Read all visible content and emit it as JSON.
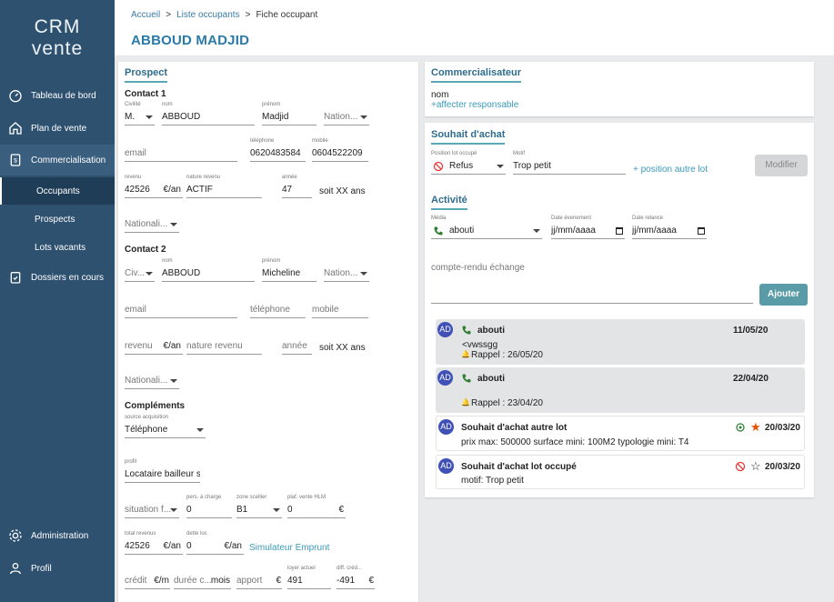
{
  "sidebar": {
    "logo_line1": "CRM",
    "logo_line2": "vente",
    "items": [
      {
        "label": "Tableau de bord"
      },
      {
        "label": "Plan de vente"
      },
      {
        "label": "Commercialisation"
      },
      {
        "label": "Dossiers en cours"
      }
    ],
    "sub_items": [
      {
        "label": "Occupants"
      },
      {
        "label": "Prospects"
      },
      {
        "label": "Lots vacants"
      }
    ],
    "bottom_items": [
      {
        "label": "Administration"
      },
      {
        "label": "Profil"
      }
    ]
  },
  "header": {
    "breadcrumb": [
      "Accueil",
      "Liste occupants",
      "Fiche occupant"
    ],
    "breadcrumb_sep": ">",
    "title": "ABBOUD MADJID"
  },
  "prospect": {
    "title": "Prospect",
    "contact1": {
      "title": "Contact 1",
      "civilite_label": "Civilité",
      "civilite": "M.",
      "nom_label": "nom",
      "nom": "ABBOUD",
      "prenom_label": "prénom",
      "prenom": "Madjid",
      "nation": "Nation...",
      "email": "email",
      "tel_label": "téléphone",
      "tel": "0620483584",
      "mobile_label": "mobile",
      "mobile": "0604522209",
      "revenu_label": "revenu",
      "revenu": "42526",
      "revenu_unit": "€/an",
      "nature_label": "nature revenu",
      "nature": "ACTIF",
      "annee_label": "année",
      "annee": "47",
      "age_text": "soit XX ans",
      "nationalite": "Nationali..."
    },
    "contact2": {
      "title": "Contact 2",
      "civilite": "Civ...",
      "nom_label": "nom",
      "nom": "ABBOUD",
      "prenom_label": "prénom",
      "prenom": "Micheline",
      "nation": "Nation...",
      "email": "email",
      "tel": "téléphone",
      "mobile": "mobile",
      "revenu": "revenu",
      "revenu_unit": "€/an",
      "nature": "nature revenu",
      "annee": "année",
      "age_text": "soit XX ans",
      "nationalite": "Nationali..."
    },
    "complements": {
      "title": "Compléments",
      "source_label": "source acquisition",
      "source": "Téléphone",
      "profil_label": "profil",
      "profil": "Locataire bailleur so",
      "situation": "situation f...",
      "pers_label": "pers. à charge",
      "pers": "0",
      "zone_label": "zone scellier",
      "zone": "B1",
      "plaf_label": "plaf. vente HLM",
      "plaf": "0",
      "plaf_unit": "€",
      "total_label": "total revenus",
      "total": "42526",
      "total_unit": "€/an",
      "dette_label": "dette loc",
      "dette": "0",
      "dette_unit": "€/an",
      "simulateur": "Simulateur Emprunt",
      "credit": "crédit",
      "credit_unit": "€/m",
      "duree": "durée c...",
      "duree_unit": "mois",
      "apport": "apport",
      "apport_unit": "€",
      "loyer_label": "loyer actuel",
      "loyer": "491",
      "diff_label": "diff. créd...",
      "diff": "-491",
      "diff_unit": "€"
    }
  },
  "commercialisateur": {
    "title": "Commercialisateur",
    "nom": "nom",
    "link": "+affecter responsable"
  },
  "souhait": {
    "title": "Souhait d'achat",
    "position_label": "Position lot occupé",
    "position": "Refus",
    "motif_label": "Motif",
    "motif": "Trop petit",
    "link": "+ position autre lot",
    "button": "Modifier"
  },
  "activite": {
    "title": "Activité",
    "media_label": "Média",
    "media": "abouti",
    "date_evt_label": "Date évenement",
    "date_evt": "jj/mm/aaaa",
    "date_rel_label": "Date relance",
    "date_rel": "jj/mm/aaaa",
    "compte_rendu": "compte-rendu échange",
    "button": "Ajouter",
    "entries": [
      {
        "avatar": "AD",
        "title": "abouti",
        "date": "11/05/20",
        "line1": "<vwssgg",
        "line2": "Rappel : 26/05/20"
      },
      {
        "avatar": "AD",
        "title": "abouti",
        "date": "22/04/20",
        "line1": "",
        "line2": "Rappel : 23/04/20"
      },
      {
        "avatar": "AD",
        "title": "Souhait d'achat autre lot",
        "date": "20/03/20",
        "line1": "prix max: 500000  surface mini: 100M2  typologie mini: T4"
      },
      {
        "avatar": "AD",
        "title": "Souhait d'achat lot occupé",
        "date": "20/03/20",
        "line1": "motif: Trop petit"
      }
    ]
  },
  "colors": {
    "sidebar": "#2e5170",
    "accent": "#2a7aa8",
    "teal": "#5a9ba8",
    "star": "#e65100",
    "refus": "#e53935",
    "phone": "#2e7d32"
  }
}
